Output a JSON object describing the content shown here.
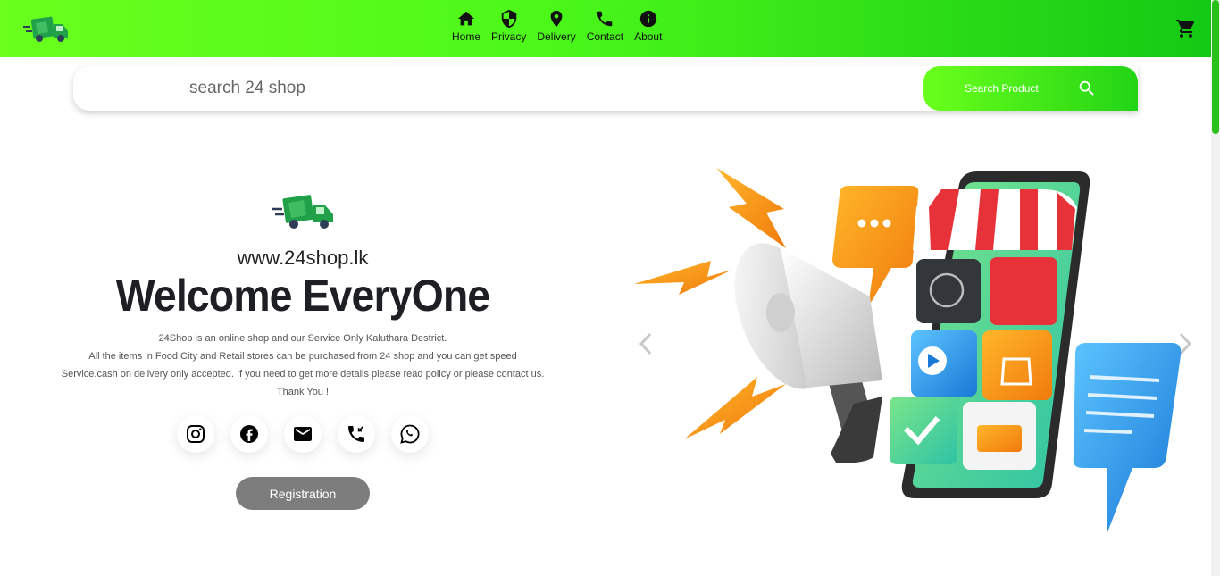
{
  "header": {
    "nav": [
      {
        "label": "Home",
        "icon": "home-icon"
      },
      {
        "label": "Privacy",
        "icon": "shield-icon"
      },
      {
        "label": "Delivery",
        "icon": "location-pin-icon"
      },
      {
        "label": "Contact",
        "icon": "phone-icon"
      },
      {
        "label": "About",
        "icon": "info-icon"
      }
    ],
    "cart_icon": "shopping-cart-icon"
  },
  "search": {
    "placeholder": "search 24 shop",
    "button_label": "Search Product"
  },
  "hero": {
    "site_url": "www.24shop.lk",
    "welcome": "Welcome EveryOne",
    "desc_lines": [
      "24Shop is an online shop and our Service Only Kaluthara Destrict.",
      "All the items in Food City and Retail stores can be purchased from 24 shop and you can get speed",
      "Service.cash on delivery only accepted. If you need to get more details please read policy or please contact us.",
      "Thank You !"
    ],
    "socials": [
      "instagram-icon",
      "facebook-icon",
      "mail-icon",
      "phone-callback-icon",
      "whatsapp-icon"
    ],
    "registration_label": "Registration"
  },
  "colors": {
    "brand_green_light": "#6aff1c",
    "brand_green_dark": "#14c914",
    "welcome_text": "#1e1f24",
    "button_gray": "#7d7d7d"
  }
}
